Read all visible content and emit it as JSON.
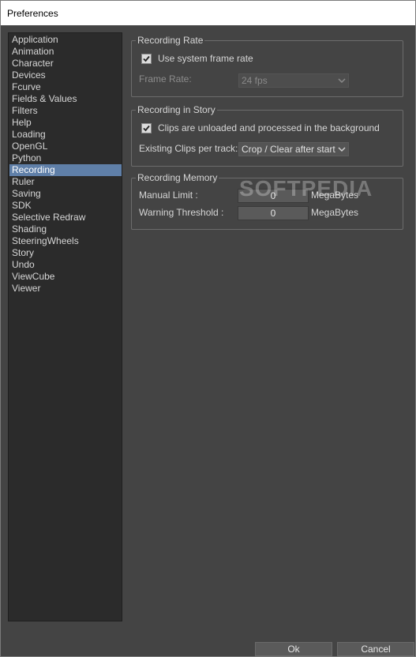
{
  "window": {
    "title": "Preferences"
  },
  "sidebar": {
    "items": [
      {
        "label": "Application"
      },
      {
        "label": "Animation"
      },
      {
        "label": "Character"
      },
      {
        "label": "Devices"
      },
      {
        "label": "Fcurve"
      },
      {
        "label": "Fields & Values"
      },
      {
        "label": "Filters"
      },
      {
        "label": "Help"
      },
      {
        "label": "Loading"
      },
      {
        "label": "OpenGL"
      },
      {
        "label": "Python"
      },
      {
        "label": "Recording",
        "selected": true
      },
      {
        "label": "Ruler"
      },
      {
        "label": "Saving"
      },
      {
        "label": "SDK"
      },
      {
        "label": "Selective Redraw"
      },
      {
        "label": "Shading"
      },
      {
        "label": "SteeringWheels"
      },
      {
        "label": "Story"
      },
      {
        "label": "Undo"
      },
      {
        "label": "ViewCube"
      },
      {
        "label": "Viewer"
      }
    ]
  },
  "recording_rate": {
    "legend": "Recording Rate",
    "use_system_label": "Use system frame rate",
    "use_system_checked": true,
    "frame_rate_label": "Frame Rate:",
    "frame_rate_value": "24 fps"
  },
  "recording_story": {
    "legend": "Recording in Story",
    "unload_label": "Clips are unloaded and processed in the background",
    "unload_checked": true,
    "existing_clips_label": "Existing Clips per track:",
    "existing_clips_value": "Crop / Clear after start"
  },
  "recording_memory": {
    "legend": "Recording Memory",
    "manual_limit_label": "Manual Limit :",
    "manual_limit_value": "0",
    "manual_limit_unit": "MegaBytes",
    "warning_label": "Warning Threshold :",
    "warning_value": "0",
    "warning_unit": "MegaBytes"
  },
  "watermark": "SOFTPEDIA",
  "buttons": {
    "ok": "Ok",
    "cancel": "Cancel"
  },
  "colors": {
    "selection": "#5f7fa8",
    "background": "#444444",
    "sidebar": "#2b2b2b"
  }
}
